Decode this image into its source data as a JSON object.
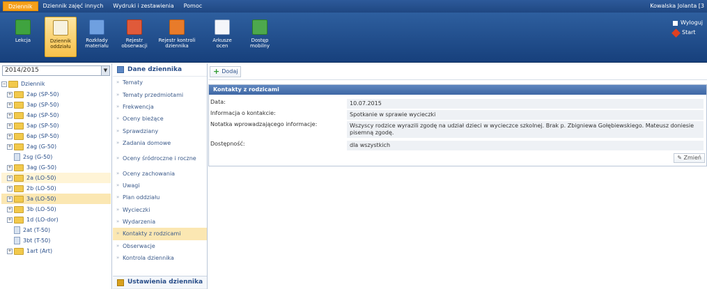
{
  "menu": {
    "items": [
      "Dziennik",
      "Dziennik zajęć innych",
      "Wydruki i zestawienia",
      "Pomoc"
    ],
    "active_index": 0,
    "user": "Kowalska Jolanta [3"
  },
  "ribbon": {
    "buttons": [
      {
        "label": "Lekcja",
        "icon": "lesson-icon"
      },
      {
        "label": "Dziennik oddziału",
        "icon": "class-journal-icon",
        "active": true
      },
      {
        "label": "Rozkłady materiału",
        "icon": "material-plan-icon"
      },
      {
        "label": "Rejestr obserwacji",
        "icon": "observation-register-icon"
      },
      {
        "label": "Rejestr kontroli dziennika",
        "icon": "control-register-icon"
      },
      {
        "label": "Arkusze ocen",
        "icon": "grade-sheets-icon"
      },
      {
        "label": "Dostęp mobilny",
        "icon": "mobile-access-icon"
      }
    ],
    "logout_label": "Wyloguj",
    "start_label": "Start"
  },
  "left": {
    "year": "2014/2015",
    "tree": [
      {
        "label": "Dziennik",
        "kind": "root"
      },
      {
        "label": "2ap (SP-50)",
        "kind": "folder"
      },
      {
        "label": "3ap (SP-50)",
        "kind": "folder"
      },
      {
        "label": "4ap (SP-50)",
        "kind": "folder"
      },
      {
        "label": "5ap (SP-50)",
        "kind": "folder"
      },
      {
        "label": "6ap (SP-50)",
        "kind": "folder"
      },
      {
        "label": "2ag (G-50)",
        "kind": "folder"
      },
      {
        "label": "2sg (G-50)",
        "kind": "doc"
      },
      {
        "label": "3ag (G-50)",
        "kind": "folder"
      },
      {
        "label": "2a (LO-50)",
        "kind": "folder",
        "state": "hover"
      },
      {
        "label": "2b (LO-50)",
        "kind": "folder"
      },
      {
        "label": "3a (LO-50)",
        "kind": "folder",
        "state": "selected"
      },
      {
        "label": "3b (LO-50)",
        "kind": "folder"
      },
      {
        "label": "1d (LO-dor)",
        "kind": "folder"
      },
      {
        "label": "2at (T-50)",
        "kind": "doc"
      },
      {
        "label": "3bt (T-50)",
        "kind": "doc"
      },
      {
        "label": "1art (Art)",
        "kind": "folder"
      }
    ]
  },
  "nav": {
    "header": "Dane dziennika",
    "items": [
      "Tematy",
      "Tematy przedmiotami",
      "Frekwencja",
      "Oceny bieżące",
      "Sprawdziany",
      "Zadania domowe",
      "Oceny śródroczne i roczne",
      "Oceny zachowania",
      "Uwagi",
      "Plan oddziału",
      "Wycieczki",
      "Wydarzenia",
      "Kontakty z rodzicami",
      "Obserwacje",
      "Kontrola dziennika"
    ],
    "active_index": 12,
    "footer": "Ustawienia dziennika"
  },
  "content": {
    "add_label": "Dodaj",
    "panel_title": "Kontakty z rodzicami",
    "fields": [
      {
        "key": "Data:",
        "value": "10.07.2015"
      },
      {
        "key": "Informacja o kontakcie:",
        "value": "Spotkanie w sprawie wycieczki"
      },
      {
        "key": "Notatka wprowadzającego informacje:",
        "value": "Wszyscy rodzice wyrazili zgodę na udział dzieci w wycieczce szkolnej. Brak p. Zbigniewa Gołębiewskiego. Mateusz doniesie pisemną zgodę."
      },
      {
        "key": "Dostępność:",
        "value": "dla wszystkich"
      }
    ],
    "edit_label": "Zmień"
  }
}
